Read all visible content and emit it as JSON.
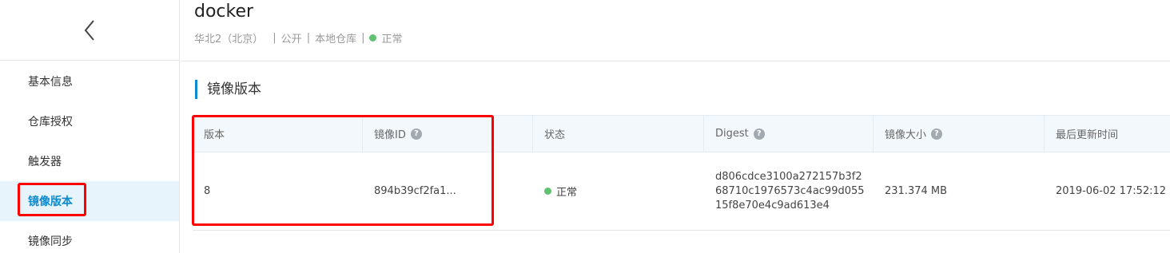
{
  "sidebar": {
    "back_icon": "chevron-left-icon",
    "items": [
      {
        "label": "基本信息",
        "active": false
      },
      {
        "label": "仓库授权",
        "active": false
      },
      {
        "label": "触发器",
        "active": false
      },
      {
        "label": "镜像版本",
        "active": true
      },
      {
        "label": "镜像同步",
        "active": false
      }
    ]
  },
  "header": {
    "title": "docker",
    "region": "华北2（北京）",
    "visibility": "公开",
    "repo_type": "本地仓库",
    "status": "正常",
    "status_color": "#5ec26e"
  },
  "section": {
    "title": "镜像版本",
    "accent_color": "#0d8bcf"
  },
  "table": {
    "columns": [
      {
        "label": "版本",
        "help": false
      },
      {
        "label": "镜像ID",
        "help": true
      },
      {
        "label": "状态",
        "help": false
      },
      {
        "label": "Digest",
        "help": true
      },
      {
        "label": "镜像大小",
        "help": true
      },
      {
        "label": "最后更新时间",
        "help": false
      }
    ],
    "help_icon": "question-circle-icon",
    "rows": [
      {
        "version": "8",
        "image_id": "894b39cf2fa1...",
        "status": "正常",
        "digest_lines": [
          "d806cdce3100a272157b3f2",
          "68710c1976573c4ac99d055",
          "15f8e70e4c9ad613e4"
        ],
        "size": "231.374 MB",
        "updated": "2019-06-02 17:52:12"
      }
    ]
  },
  "annotations": {
    "highlight_color": "#ff0000"
  }
}
